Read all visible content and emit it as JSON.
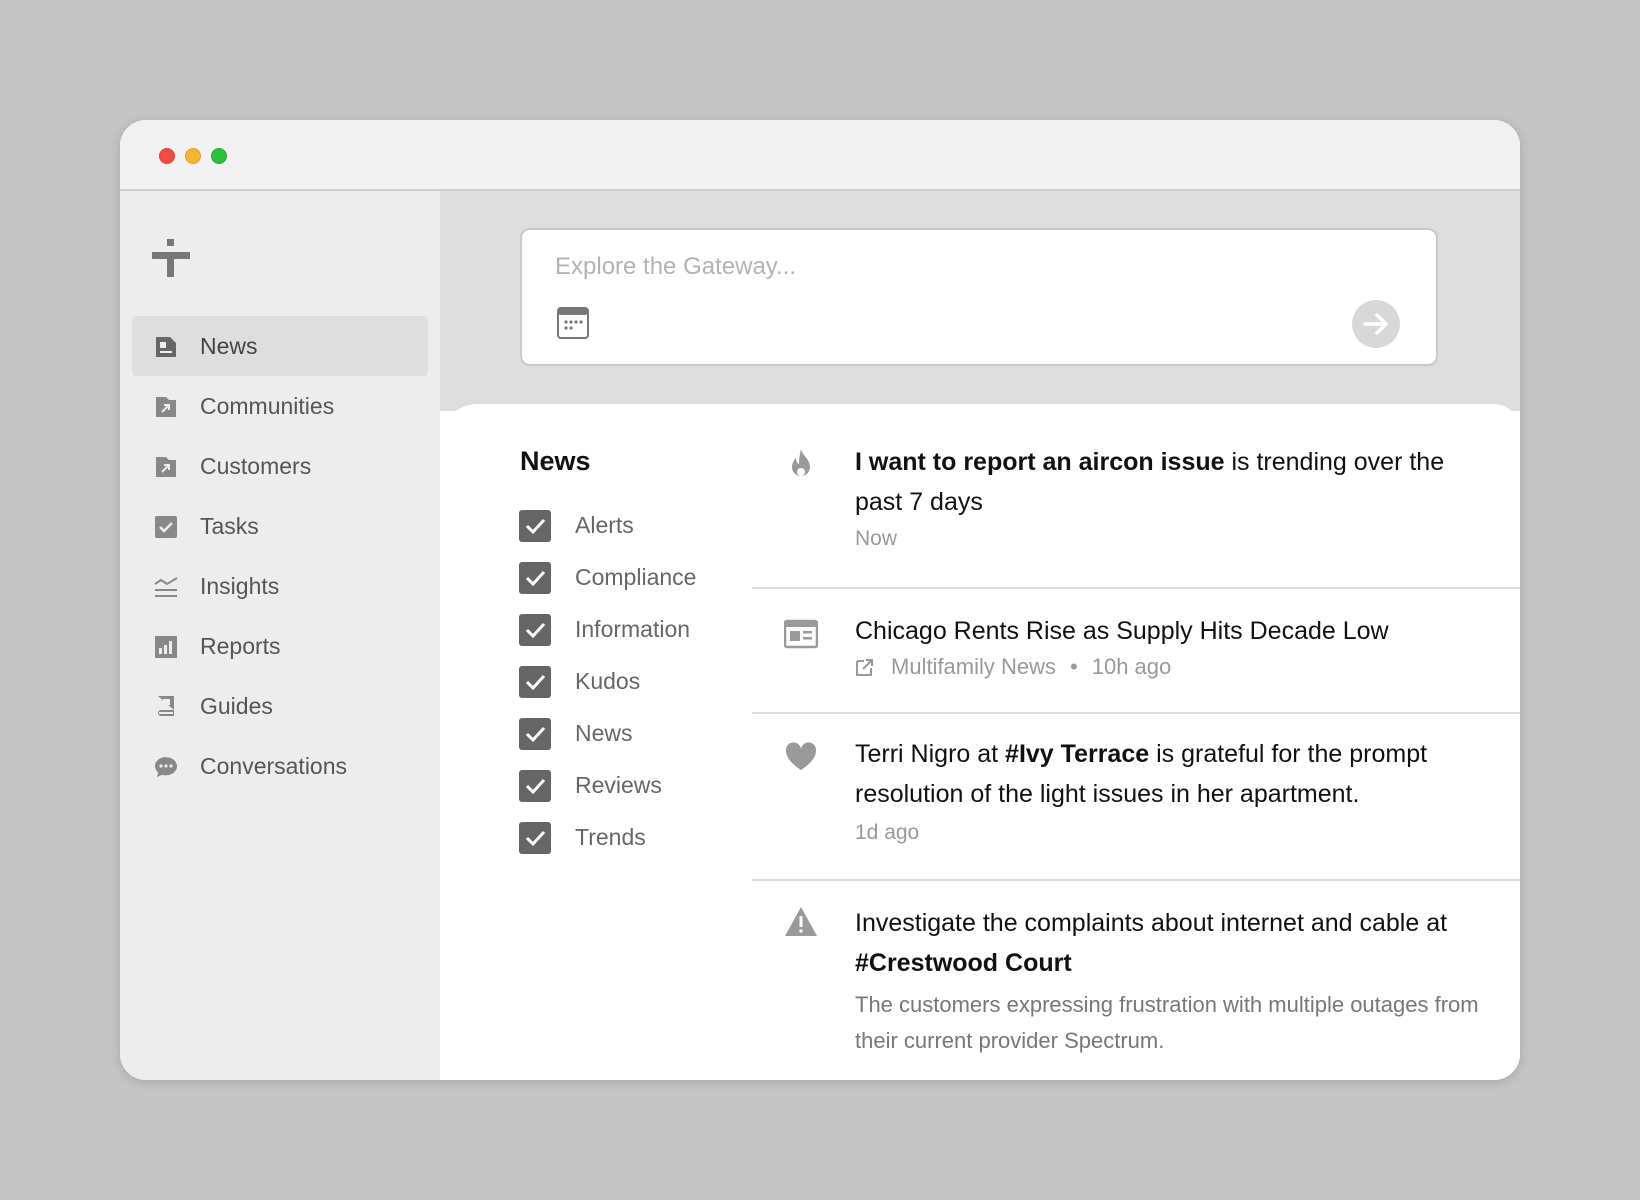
{
  "sidebar": {
    "items": [
      {
        "label": "News",
        "icon": "newspaper-icon",
        "active": true
      },
      {
        "label": "Communities",
        "icon": "building-arrow-icon",
        "active": false
      },
      {
        "label": "Customers",
        "icon": "building-arrow-icon",
        "active": false
      },
      {
        "label": "Tasks",
        "icon": "checkbox-icon",
        "active": false
      },
      {
        "label": "Insights",
        "icon": "chart-area-icon",
        "active": false
      },
      {
        "label": "Reports",
        "icon": "bar-chart-icon",
        "active": false
      },
      {
        "label": "Guides",
        "icon": "book-icon",
        "active": false
      },
      {
        "label": "Conversations",
        "icon": "chat-bubble-icon",
        "active": false
      }
    ]
  },
  "search": {
    "placeholder": "Explore the Gateway...",
    "value": ""
  },
  "filters": {
    "title": "News",
    "items": [
      {
        "label": "Alerts",
        "checked": true
      },
      {
        "label": "Compliance",
        "checked": true
      },
      {
        "label": "Information",
        "checked": true
      },
      {
        "label": "Kudos",
        "checked": true
      },
      {
        "label": "News",
        "checked": true
      },
      {
        "label": "Reviews",
        "checked": true
      },
      {
        "label": "Trends",
        "checked": true
      }
    ]
  },
  "feed": {
    "item1": {
      "icon": "flame-icon",
      "title_bold": "I want to report an aircon issue",
      "title_rest": " is trending over the past 7 days",
      "time": "Now"
    },
    "item2": {
      "icon": "article-icon",
      "title": "Chicago Rents Rise as Supply Hits Decade Low",
      "source": "Multifamily News",
      "separator": "•",
      "time": "10h ago"
    },
    "item3": {
      "icon": "heart-icon",
      "title_pre": "Terri Nigro at ",
      "title_tag": "#Ivy Terrace",
      "title_post": " is grateful for the prompt resolution of the light issues in her apartment.",
      "time": "1d ago"
    },
    "item4": {
      "icon": "warning-icon",
      "title_pre": "Investigate the complaints about internet and cable at ",
      "title_tag": "#Crestwood Court",
      "description": "The customers expressing frustration with multiple outages from their current provider Spectrum."
    }
  },
  "colors": {
    "background": "#c4c4c4",
    "sidebar": "#ededed",
    "sidebar_active": "#dedede",
    "icon_gray": "#777777",
    "checkbox": "#666666"
  }
}
